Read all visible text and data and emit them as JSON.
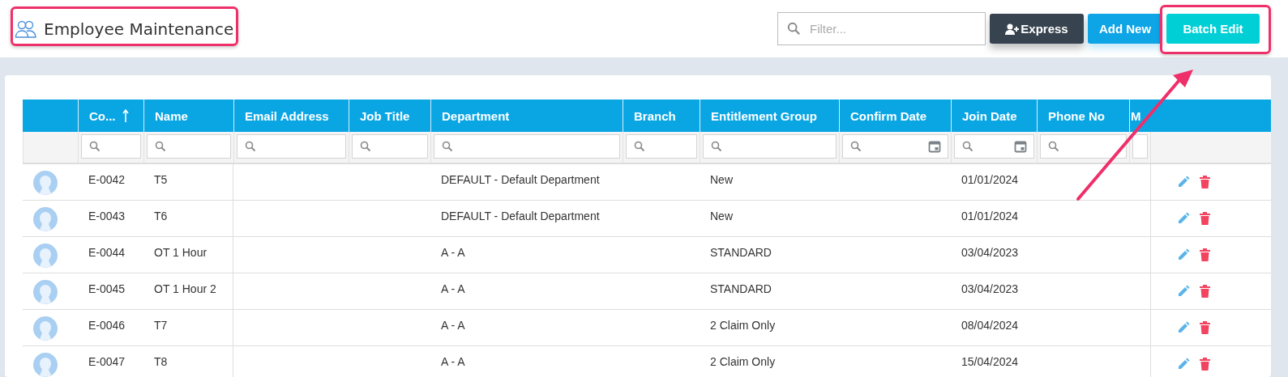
{
  "page": {
    "title": "Employee Maintenance"
  },
  "toolbar": {
    "filter": {
      "placeholder": "Filter..."
    },
    "buttons": [
      {
        "label": "Express",
        "kind": "dark"
      },
      {
        "label": "Add New",
        "kind": "primary"
      },
      {
        "label": "Batch Edit",
        "kind": "accent"
      }
    ]
  },
  "table": {
    "columns": [
      {
        "label": "Co...",
        "sorted": true,
        "date_filter": false
      },
      {
        "label": "Name",
        "sorted": false,
        "date_filter": false
      },
      {
        "label": "Email Address",
        "sorted": false,
        "date_filter": false
      },
      {
        "label": "Job Title",
        "sorted": false,
        "date_filter": false
      },
      {
        "label": "Department",
        "sorted": false,
        "date_filter": false
      },
      {
        "label": "Branch",
        "sorted": false,
        "date_filter": false
      },
      {
        "label": "Entitlement Group",
        "sorted": false,
        "date_filter": false
      },
      {
        "label": "Confirm Date",
        "sorted": false,
        "date_filter": true
      },
      {
        "label": "Join Date",
        "sorted": false,
        "date_filter": true
      },
      {
        "label": "Phone No",
        "sorted": false,
        "date_filter": false
      },
      {
        "label": "M",
        "sorted": false,
        "date_filter": false
      }
    ],
    "rows": [
      {
        "code": "E-0042",
        "name": "T5",
        "department": "DEFAULT - Default Department",
        "entitlement_group": "New",
        "join_date": "01/01/2024"
      },
      {
        "code": "E-0043",
        "name": "T6",
        "department": "DEFAULT - Default Department",
        "entitlement_group": "New",
        "join_date": "01/01/2024"
      },
      {
        "code": "E-0044",
        "name": "OT 1 Hour",
        "department": "A - A",
        "entitlement_group": "STANDARD",
        "join_date": "03/04/2023"
      },
      {
        "code": "E-0045",
        "name": "OT 1 Hour 2",
        "department": "A - A",
        "entitlement_group": "STANDARD",
        "join_date": "03/04/2023"
      },
      {
        "code": "E-0046",
        "name": "T7",
        "department": "A - A",
        "entitlement_group": "2 Claim Only",
        "join_date": "08/04/2024"
      },
      {
        "code": "E-0047",
        "name": "T8",
        "department": "A - A",
        "entitlement_group": "2 Claim Only",
        "join_date": "15/04/2024"
      }
    ]
  },
  "annotations": [
    {
      "kind": "frame"
    },
    {
      "kind": "frame"
    },
    {
      "kind": "arrow"
    }
  ]
}
